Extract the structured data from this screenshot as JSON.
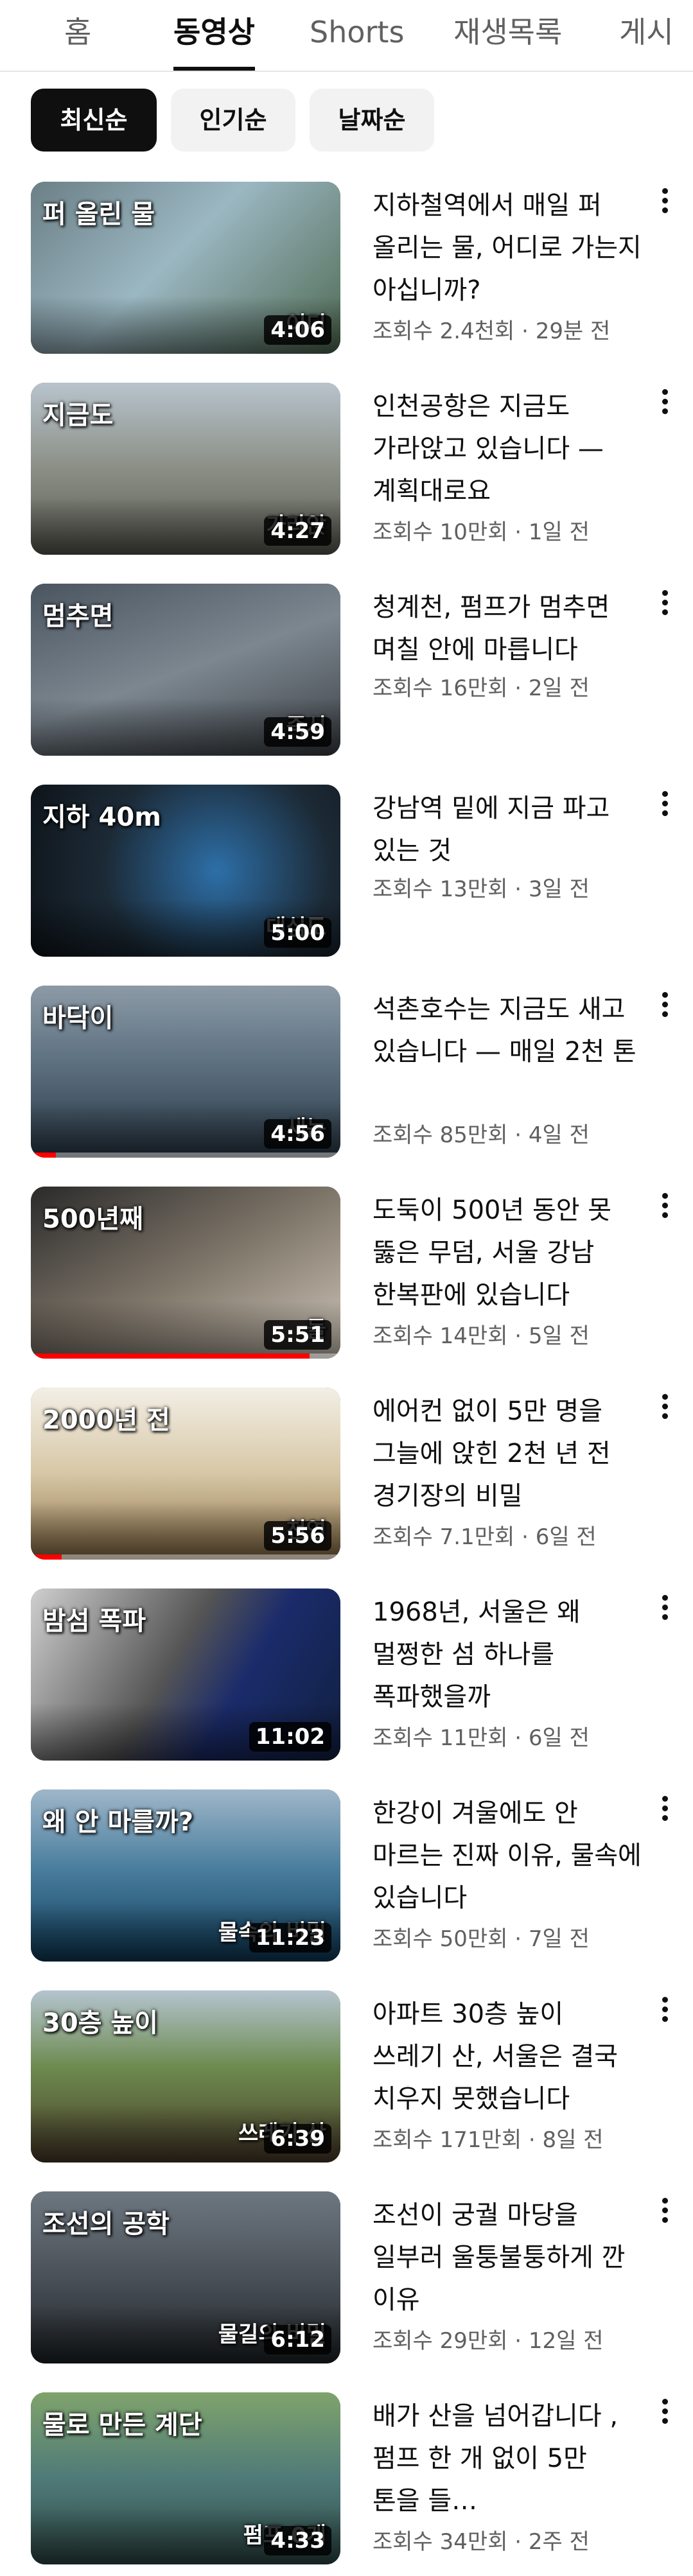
{
  "tabs": [
    {
      "label": "홈",
      "active": false
    },
    {
      "label": "동영상",
      "active": true
    },
    {
      "label": "Shorts",
      "active": false
    },
    {
      "label": "재생목록",
      "active": false
    },
    {
      "label": "게시",
      "active": false
    }
  ],
  "chips": [
    {
      "label": "최신순",
      "active": true
    },
    {
      "label": "인기순",
      "active": false
    },
    {
      "label": "날짜순",
      "active": false
    }
  ],
  "videos": [
    {
      "title": "지하철역에서 매일 퍼 올리는 물, 어디로 가는지 아십니까?",
      "meta": "조회수 2.4천회 · 29분 전",
      "duration": "4:06",
      "overlay": "퍼 올린 물",
      "overlay2": "어디",
      "watched": 0
    },
    {
      "title": "인천공항은 지금도 가라앉고 있습니다 — 계획대로요",
      "meta": "조회수 10만회 · 1일 전",
      "duration": "4:27",
      "overlay": "지금도",
      "overlay2": "가라앉",
      "watched": 0
    },
    {
      "title": "청계천, 펌프가 멈추면 며칠 안에 마릅니다",
      "meta": "조회수 16만회 · 2일 전",
      "duration": "4:59",
      "overlay": "멈추면",
      "overlay2": "즉시",
      "watched": 0
    },
    {
      "title": "강남역 밑에 지금 파고 있는 것",
      "meta": "조회수 13만회 · 3일 전",
      "duration": "5:00",
      "overlay": "지하 40m",
      "overlay2": "대심도",
      "watched": 0
    },
    {
      "title": "석촌호수는 지금도 새고 있습니다 — 매일 2천 톤",
      "meta": "조회수 85만회 · 4일 전",
      "duration": "4:56",
      "overlay": "바닥이",
      "overlay2": "새는",
      "watched": 0.08
    },
    {
      "title": "도둑이 500년 동안 못 뚫은 무덤, 서울 강남 한복판에 있습니다",
      "meta": "조회수 14만회 · 5일 전",
      "duration": "5:51",
      "overlay": "500년째",
      "overlay2": "들",
      "watched": 0.9
    },
    {
      "title": "에어컨 없이 5만 명을 그늘에 앉힌 2천 년 전 경기장의 비밀",
      "meta": "조회수 7.1만회 · 6일 전",
      "duration": "5:56",
      "overlay": "2000년 전",
      "overlay2": "천연",
      "watched": 0.1
    },
    {
      "title": "1968년, 서울은 왜 멀쩡한 섬 하나를 폭파했을까",
      "meta": "조회수 11만회 · 6일 전",
      "duration": "11:02",
      "overlay": "밤섬 폭파",
      "overlay2": "",
      "watched": 0
    },
    {
      "title": "한강이 겨울에도 안 마르는 진짜 이유, 물속에 있습니다",
      "meta": "조회수 50만회 · 7일 전",
      "duration": "11:23",
      "overlay": "왜 안 마를까?",
      "overlay2": "물속의 비밀",
      "watched": 0
    },
    {
      "title": "아파트 30층 높이 쓰레기 산, 서울은 결국 치우지 못했습니다",
      "meta": "조회수 171만회 · 8일 전",
      "duration": "6:39",
      "overlay": "30층 높이",
      "overlay2": "쓰레기 산",
      "watched": 0
    },
    {
      "title": "조선이 궁궐 마당을 일부러 울퉁불퉁하게 깐 이유",
      "meta": "조회수 29만회 · 12일 전",
      "duration": "6:12",
      "overlay": "조선의 공학",
      "overlay2": "물길의 비밀",
      "watched": 0
    },
    {
      "title": "배가 산을 넘어갑니다 ,펌프 한 개 없이 5만 톤을 들…",
      "meta": "조회수 34만회 · 2주 전",
      "duration": "4:33",
      "overlay": "물로 만든 계단",
      "overlay2": "펌프 0개",
      "watched": 0
    }
  ],
  "colors": {
    "progress": "#ff0000",
    "text": "#0f0f0f",
    "secondary": "#606060",
    "chip_bg": "#f2f2f2"
  },
  "icons": {
    "more": "more-vert-icon"
  }
}
